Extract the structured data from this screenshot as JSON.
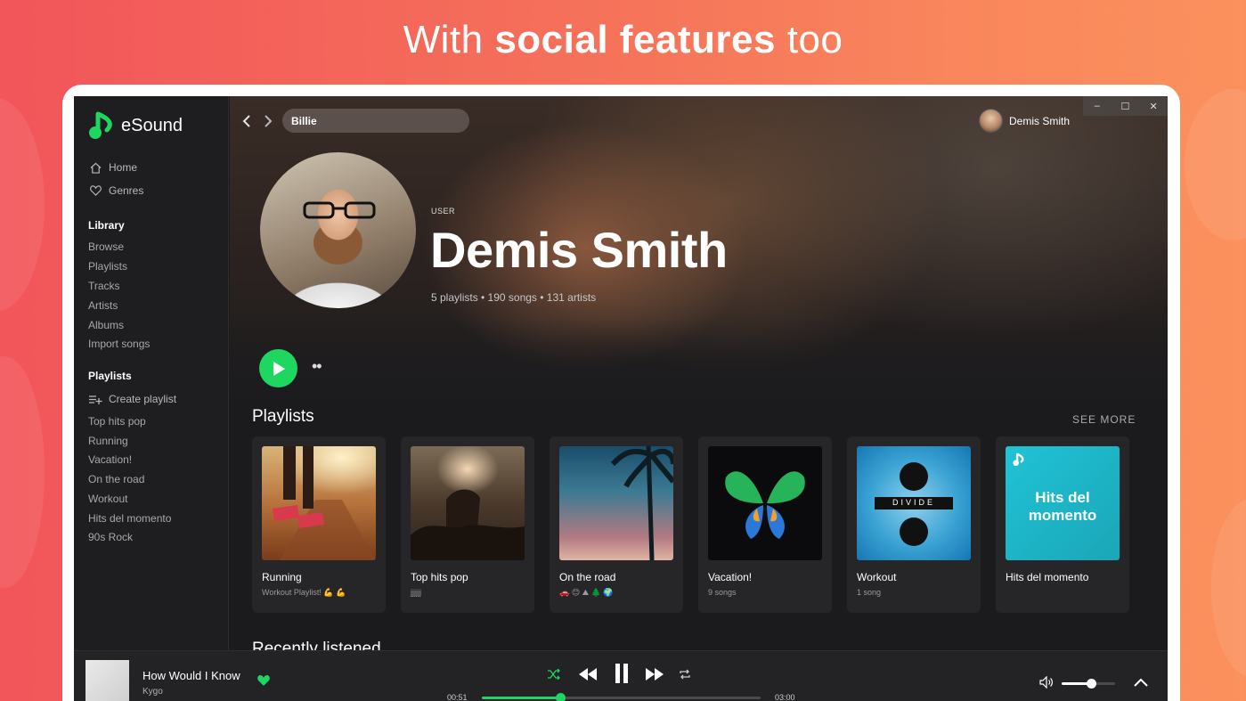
{
  "promo": {
    "prefix": "With",
    "bold": "social features",
    "suffix": "too"
  },
  "app": {
    "name": "eSound",
    "accent": "#1ed760"
  },
  "sidebar": {
    "nav": [
      {
        "label": "Home",
        "icon": "home-icon"
      },
      {
        "label": "Genres",
        "icon": "heart-outline-icon"
      }
    ],
    "library_heading": "Library",
    "library_items": [
      "Browse",
      "Playlists",
      "Tracks",
      "Artists",
      "Albums",
      "Import songs"
    ],
    "playlists_heading": "Playlists",
    "create_playlist": "Create playlist",
    "playlist_items": [
      "Top hits pop",
      "Running",
      "Vacation!",
      "On the road",
      "Workout",
      "Hits del momento",
      "90s Rock"
    ]
  },
  "topbar": {
    "search_value": "Billie",
    "user_name": "Demis Smith",
    "window_controls": [
      "–",
      "☐",
      "✕"
    ]
  },
  "profile": {
    "tag": "USER",
    "name": "Demis Smith",
    "meta": "5 playlists • 190 songs • 131 artists"
  },
  "playlists_section": {
    "heading": "Playlists",
    "see_more": "SEE MORE",
    "cards": [
      {
        "title": "Running",
        "subtitle": "Workout Playlist! 💪 💪"
      },
      {
        "title": "Top hits pop",
        "subtitle": "jjjjjj"
      },
      {
        "title": "On the road",
        "subtitle": "🚗 😊 ⛰ 🌲 🌍"
      },
      {
        "title": "Vacation!",
        "subtitle": "9 songs"
      },
      {
        "title": "Workout",
        "subtitle": "1 song"
      },
      {
        "title": "Hits del momento",
        "subtitle": ""
      }
    ],
    "hits_cover_text": "Hits del momento",
    "workout_cover_text": "DIVIDE"
  },
  "recent_heading": "Recently listened",
  "player": {
    "title": "How Would I Know",
    "artist": "Kygo",
    "elapsed": "00:51",
    "duration": "03:00",
    "progress": 0.28,
    "volume": 0.55,
    "liked": true
  }
}
